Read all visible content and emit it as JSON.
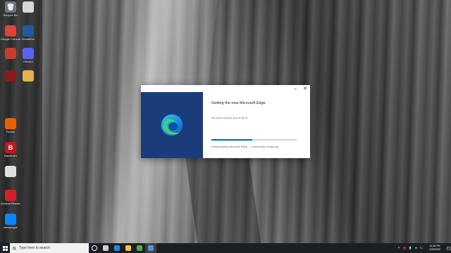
{
  "desktop": {
    "icons": [
      {
        "label": "Recycle Bin",
        "glyph": "🗑",
        "color": "#6d7780",
        "icon": "recycle-bin-icon"
      },
      {
        "label": "",
        "glyph": "",
        "color": "#d7d7d7",
        "icon": "document-icon"
      },
      {
        "label": "Google Chrome",
        "glyph": "",
        "color": "#db4437",
        "icon": "chrome-icon"
      },
      {
        "label": "VirtualBox",
        "glyph": "",
        "color": "#1f5a9e",
        "icon": "virtualbox-icon"
      },
      {
        "label": "",
        "glyph": "",
        "color": "#c73a2e",
        "icon": "app-icon"
      },
      {
        "label": "Discord",
        "glyph": "",
        "color": "#5865f2",
        "icon": "discord-icon"
      },
      {
        "label": "",
        "glyph": "",
        "color": "#8b1b1b",
        "icon": "app-icon"
      },
      {
        "label": "",
        "glyph": "",
        "color": "#e2b24b",
        "icon": "folder-icon"
      },
      {
        "label": "Firefox",
        "glyph": "",
        "color": "#e66000",
        "icon": "firefox-icon"
      },
      {
        "label": "Bandicam",
        "glyph": "B",
        "color": "#c2171c",
        "icon": "bandicam-icon"
      },
      {
        "label": "",
        "glyph": "",
        "color": "#e0e0e0",
        "icon": "disc-icon"
      },
      {
        "label": "Acrobat Reader",
        "glyph": "",
        "color": "#d4202b",
        "icon": "acrobat-icon"
      },
      {
        "label": "Messenger",
        "glyph": "",
        "color": "#0a84ff",
        "icon": "messenger-icon"
      }
    ]
  },
  "dialog": {
    "minimize": "–",
    "close": "✕",
    "heading": "Getting the new Microsoft Edge",
    "subtext": "We can't wait for you to try it!",
    "progress_fraction": 0.48,
    "status": "Downloading Microsoft Edge... 4 second(s) remaining"
  },
  "taskbar": {
    "search_placeholder": "Type here to search",
    "apps": [
      {
        "icon": "cortana-icon",
        "color": "#ffffff"
      },
      {
        "icon": "task-view-icon",
        "color": "#cfcfcf"
      },
      {
        "icon": "edge-icon",
        "color": "#1e8ae6"
      },
      {
        "icon": "file-explorer-icon",
        "color": "#f4c542"
      },
      {
        "icon": "chrome-icon",
        "color": "#4caf50"
      },
      {
        "icon": "edge-installer-icon",
        "color": "#5a8fd6"
      }
    ],
    "time": "11:46 PM",
    "date": "4/25/2020"
  }
}
